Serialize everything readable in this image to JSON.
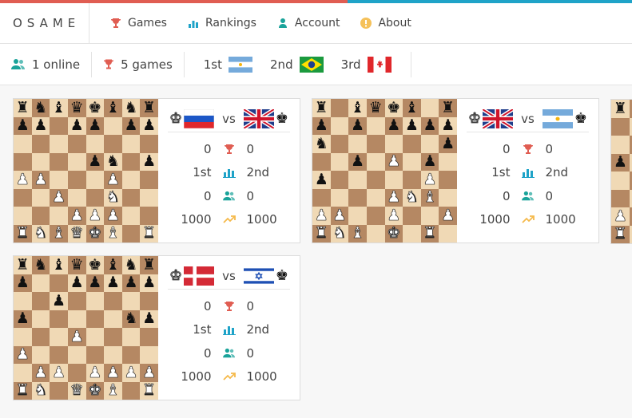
{
  "brand": "OSAME",
  "nav": [
    {
      "label": "Games",
      "icon": "trophy-icon"
    },
    {
      "label": "Rankings",
      "icon": "bar-chart-icon"
    },
    {
      "label": "Account",
      "icon": "user-icon"
    },
    {
      "label": "About",
      "icon": "info-icon"
    }
  ],
  "stats": {
    "online": "1 online",
    "games": "5 games",
    "rank1": "1st",
    "rank1_flag": "argentina",
    "rank2": "2nd",
    "rank2_flag": "brazil",
    "rank3": "3rd",
    "rank3_flag": "canada"
  },
  "colors": {
    "trophy": "#e05d52",
    "teal": "#1aa39a",
    "orange": "#f5a623",
    "light_square": "#f0d9b5",
    "dark_square": "#b58863"
  },
  "games": [
    {
      "white_flag": "russia",
      "black_flag": "uk",
      "vs": "vs",
      "board": [
        "rnbqkbnr",
        "pp.pp.pp",
        "........",
        "....pn.p",
        "PP...P..",
        "..P..N..",
        "...PPP..",
        "RNBQKB.R"
      ],
      "rows": [
        {
          "left": "0",
          "right": "0"
        },
        {
          "left": "1st",
          "right": "2nd"
        },
        {
          "left": "0",
          "right": "0"
        },
        {
          "left": "1000",
          "right": "1000"
        }
      ]
    },
    {
      "white_flag": "uk",
      "black_flag": "argentina",
      "vs": "vs",
      "board": [
        "r.bqkb.r",
        "p.p.pppp",
        "n......p",
        "..p.P.p.",
        "p.....P.",
        "....PNB.",
        "PP..P..P",
        "RNB.K.R."
      ],
      "rows": [
        {
          "left": "0",
          "right": "0"
        },
        {
          "left": "1st",
          "right": "2nd"
        },
        {
          "left": "0",
          "right": "0"
        },
        {
          "left": "1000",
          "right": "1000"
        }
      ]
    },
    {
      "white_flag": "denmark",
      "black_flag": "israel",
      "vs": "vs",
      "board": [
        "rnbqkbnr",
        "p..ppppp",
        "..p.....",
        "p.....np",
        "...P....",
        "P.......",
        ".PP.PPPP",
        "RN.QKB.R"
      ],
      "rows": [
        {
          "left": "0",
          "right": "0"
        },
        {
          "left": "1st",
          "right": "2nd"
        },
        {
          "left": "0",
          "right": "0"
        },
        {
          "left": "1000",
          "right": "1000"
        }
      ]
    }
  ],
  "peek_board": [
    "r.......",
    "........",
    "........",
    "p.......",
    ".P......",
    "........",
    "P.......",
    "R......."
  ]
}
